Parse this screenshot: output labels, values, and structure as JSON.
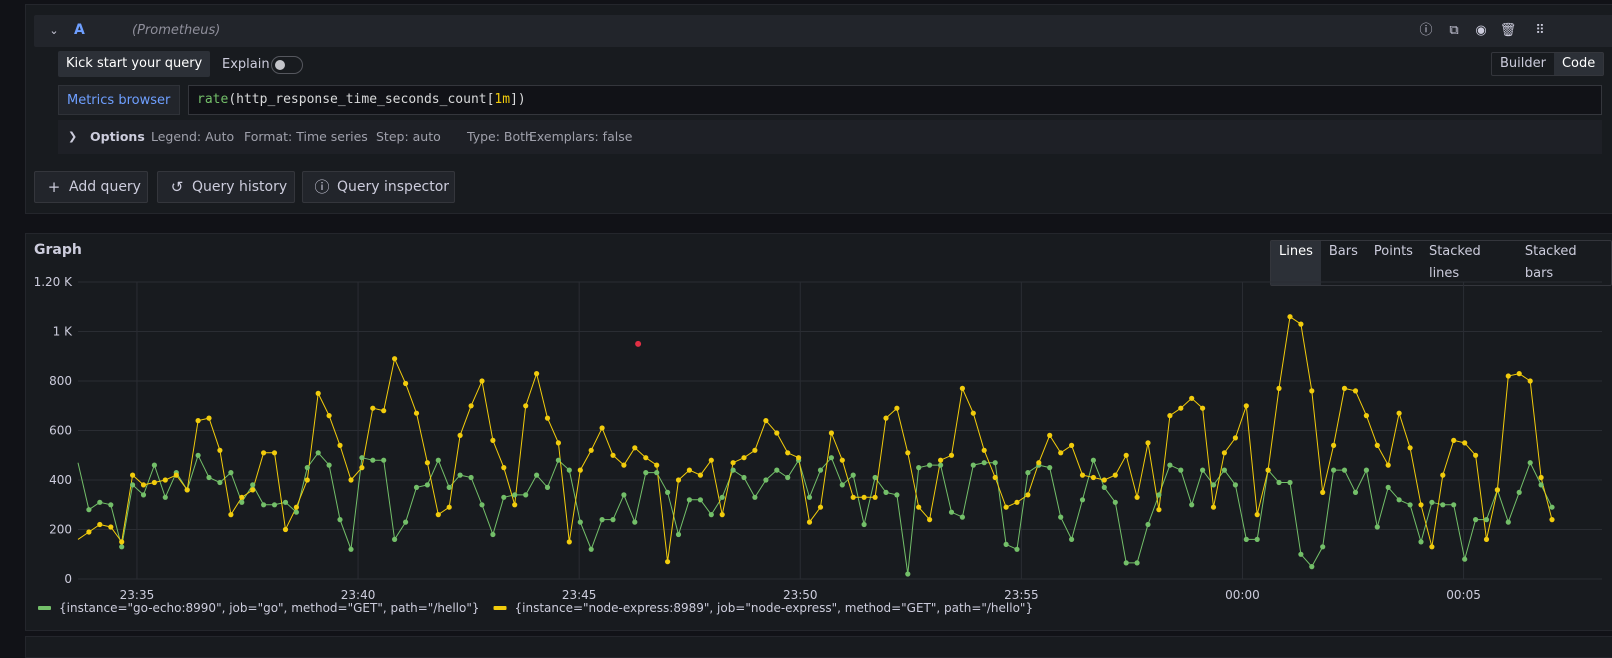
{
  "query": {
    "letter": "A",
    "datasource": "(Prometheus)",
    "kick_start": "Kick start your query",
    "explain_label": "Explain",
    "mode_builder": "Builder",
    "mode_code": "Code",
    "metrics_browser": "Metrics browser",
    "expr_fn": "rate",
    "expr_open": "(http_response_time_seconds_count[",
    "expr_range": "1m",
    "expr_close": "])",
    "options_label": "Options",
    "legend": "Legend: Auto",
    "format": "Format: Time series",
    "step": "Step: auto",
    "type": "Type: Both",
    "exemplars": "Exemplars: false"
  },
  "actions": {
    "add_query": "Add query",
    "query_history": "Query history",
    "query_inspector": "Query inspector"
  },
  "graph": {
    "title": "Graph",
    "modes": [
      "Lines",
      "Bars",
      "Points",
      "Stacked lines",
      "Stacked bars"
    ],
    "active_mode": "Lines"
  },
  "colors": {
    "go": "#73bf69",
    "node": "#f2cc0c",
    "exemplar": "#e02f44"
  },
  "chart_data": {
    "type": "line",
    "title": "",
    "xlabel": "",
    "ylabel": "",
    "x_start": "23:33:40",
    "x_end": "00:07:00",
    "x_ticks": [
      "23:35",
      "23:40",
      "23:45",
      "23:50",
      "23:55",
      "00:00",
      "00:05"
    ],
    "y_ticks": [
      "0",
      "200",
      "400",
      "600",
      "800",
      "1 K",
      "1.20 K"
    ],
    "ylim": [
      0,
      1200
    ],
    "grid": true,
    "legend_position": "bottom-left",
    "exemplar": {
      "time": "23:46:20",
      "value": 950
    },
    "series": [
      {
        "name": "{instance=\"go-echo:8990\", job=\"go\", method=\"GET\", path=\"/hello\"}",
        "color": "#73bf69",
        "values": [
          470,
          280,
          310,
          300,
          130,
          380,
          340,
          460,
          330,
          430,
          360,
          500,
          410,
          390,
          430,
          310,
          380,
          300,
          300,
          310,
          270,
          450,
          510,
          460,
          240,
          120,
          490,
          480,
          480,
          160,
          230,
          370,
          380,
          480,
          370,
          420,
          410,
          300,
          180,
          330,
          340,
          340,
          420,
          370,
          480,
          440,
          230,
          120,
          240,
          240,
          340,
          230,
          430,
          430,
          350,
          180,
          320,
          320,
          260,
          330,
          440,
          410,
          330,
          400,
          440,
          410,
          480,
          330,
          440,
          490,
          380,
          420,
          220,
          410,
          350,
          340,
          20,
          450,
          460,
          460,
          270,
          250,
          460,
          470,
          470,
          140,
          120,
          430,
          460,
          450,
          250,
          160,
          320,
          480,
          370,
          310,
          65,
          65,
          220,
          340,
          460,
          440,
          300,
          440,
          380,
          440,
          380,
          160,
          160,
          440,
          390,
          390,
          100,
          50,
          130,
          440,
          440,
          350,
          440,
          210,
          370,
          320,
          300,
          150,
          310,
          300,
          300,
          80,
          240,
          240,
          360,
          230,
          350,
          470,
          380,
          290
        ]
      },
      {
        "name": "{instance=\"node-express:8989\", job=\"node-express\", method=\"GET\", path=\"/hello\"}",
        "color": "#f2cc0c",
        "values": [
          160,
          190,
          220,
          210,
          150,
          420,
          380,
          390,
          400,
          420,
          360,
          640,
          650,
          520,
          260,
          330,
          360,
          510,
          510,
          200,
          290,
          400,
          750,
          660,
          540,
          400,
          450,
          690,
          680,
          890,
          790,
          670,
          470,
          260,
          290,
          580,
          700,
          800,
          560,
          450,
          300,
          700,
          830,
          650,
          550,
          150,
          440,
          520,
          610,
          500,
          460,
          530,
          490,
          460,
          70,
          400,
          440,
          420,
          480,
          260,
          470,
          490,
          520,
          640,
          590,
          510,
          490,
          230,
          290,
          590,
          480,
          330,
          330,
          330,
          650,
          690,
          510,
          290,
          240,
          480,
          500,
          770,
          670,
          520,
          410,
          290,
          310,
          340,
          470,
          580,
          510,
          540,
          420,
          410,
          400,
          420,
          500,
          330,
          550,
          280,
          660,
          690,
          730,
          690,
          290,
          510,
          570,
          700,
          260,
          440,
          770,
          1060,
          1030,
          760,
          350,
          540,
          770,
          760,
          660,
          540,
          460,
          670,
          530,
          300,
          130,
          420,
          560,
          550,
          500,
          160,
          360,
          820,
          830,
          800,
          410,
          240
        ]
      }
    ]
  }
}
